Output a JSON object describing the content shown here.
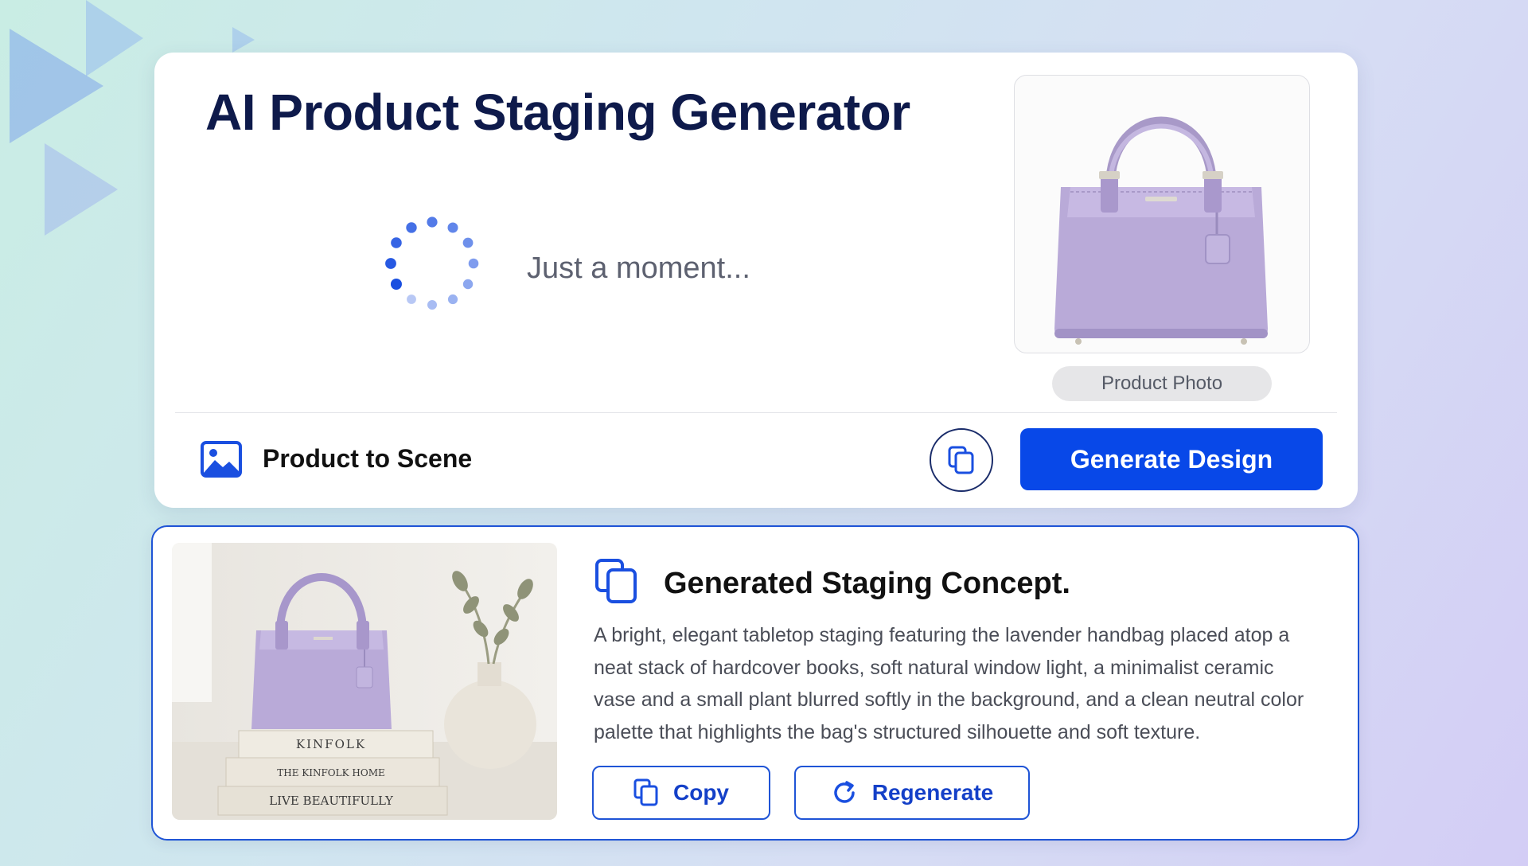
{
  "header": {
    "title": "AI Product Staging Generator"
  },
  "loading": {
    "text": "Just a moment..."
  },
  "product_photo": {
    "label": "Product Photo"
  },
  "toolbar": {
    "mode_icon": "image-icon",
    "mode_label": "Product to Scene",
    "copy_icon": "copy-icon",
    "generate_label": "Generate Design"
  },
  "result": {
    "icon": "copy-icon",
    "title": "Generated Staging Concept.",
    "description": "A bright, elegant tabletop staging featuring the lavender handbag placed atop a neat stack of hardcover books, soft natural window light, a minimalist ceramic vase and a small plant blurred softly in the background, and a clean neutral color palette that highlights the bag's structured silhouette and soft texture.",
    "books": [
      "KINFOLK",
      "THE KINFOLK HOME",
      "LIVE BEAUTIFULLY"
    ],
    "copy_label": "Copy",
    "regenerate_label": "Regenerate"
  },
  "colors": {
    "accent": "#0848e8",
    "title": "#0e1a4b",
    "bag": "#b8a9d6"
  }
}
